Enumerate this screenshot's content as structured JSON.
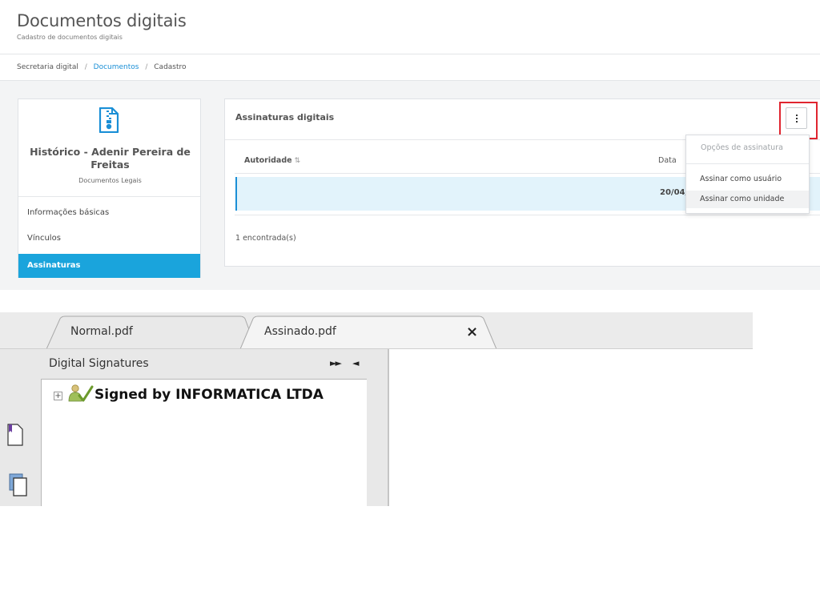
{
  "app": {
    "header": {
      "title": "Documentos digitais",
      "subtitle": "Cadastro de documentos digitais"
    },
    "breadcrumb": [
      "Secretaria digital",
      "Documentos",
      "Cadastro"
    ],
    "breadcrumb_separator": "/",
    "document": {
      "title": "Histórico - Adenir Pereira de Freitas",
      "category": "Documentos Legais",
      "icon": "zip-file-icon"
    },
    "menu": [
      {
        "label": "Informações básicas",
        "active": false
      },
      {
        "label": "Vínculos",
        "active": false
      },
      {
        "label": "Assinaturas",
        "active": true
      }
    ],
    "signatures_panel": {
      "title": "Assinaturas digitais",
      "columns": {
        "authority": "Autoridade",
        "date": "Data"
      },
      "sort_icon": "sort-icon",
      "rows": [
        {
          "authority": "",
          "date": "20/04/"
        }
      ],
      "count_text": "1 encontrada(s)"
    },
    "options_menu": {
      "header": "Opções de assinatura",
      "items": [
        "Assinar como usuário",
        "Assinar como unidade"
      ],
      "hovered_index": 1
    },
    "colors": {
      "accent": "#1aa4dc",
      "link": "#1a8fd6",
      "row_highlight": "#e2f3fb",
      "highlight_box": "#e0252f"
    }
  },
  "pdf_viewer": {
    "tabs": [
      {
        "label": "Normal.pdf"
      },
      {
        "label": "Assinado.pdf",
        "closable": true
      }
    ],
    "close_glyph": "×",
    "panel": {
      "title": "Digital Signatures",
      "controls": [
        "►►",
        "◄"
      ]
    },
    "signature_tree": [
      {
        "label": "Signed by INFORMATICA LTDA",
        "expander": "+",
        "icon": "signature-valid-icon"
      }
    ],
    "sidebar_icons": [
      "bookmark-icon",
      "pages-icon"
    ]
  }
}
